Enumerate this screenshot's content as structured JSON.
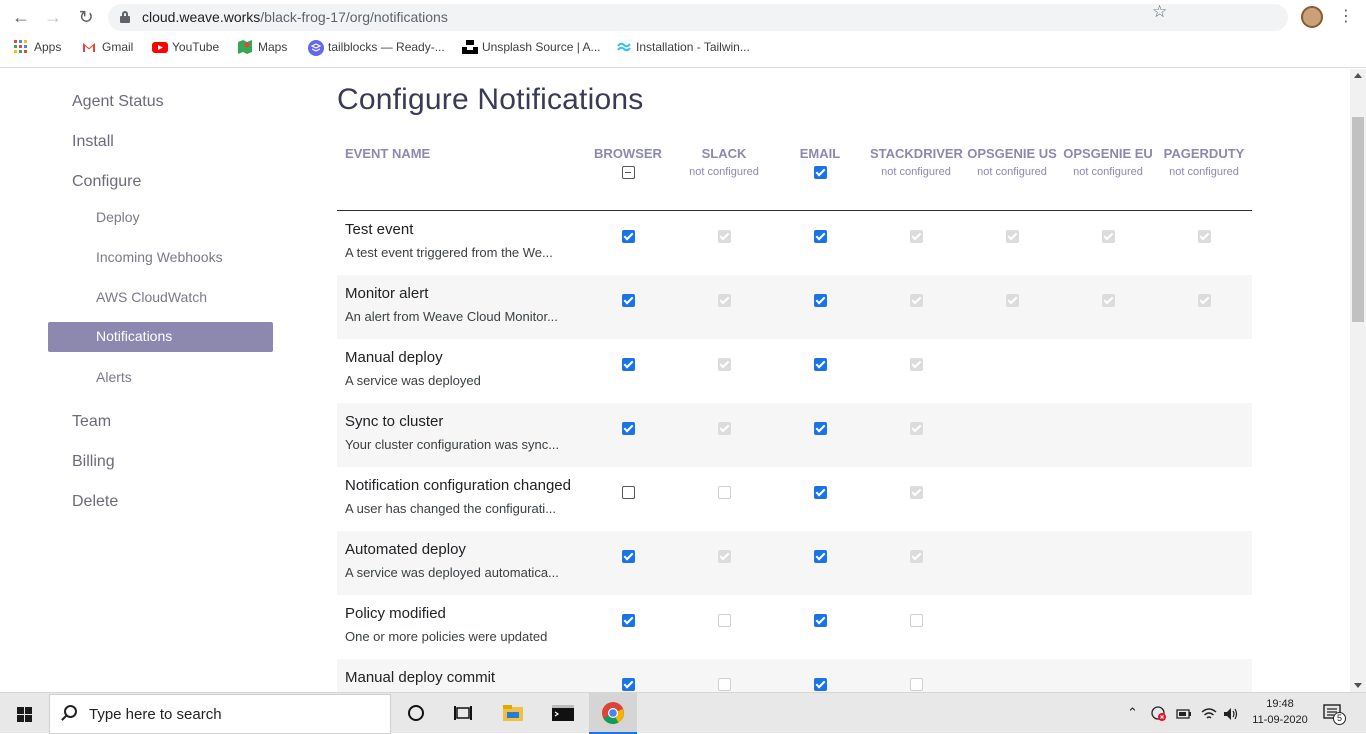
{
  "browser": {
    "url_host": "cloud.weave.works",
    "url_path": "/black-frog-17/org/notifications",
    "bookmarks": [
      {
        "label": "Apps",
        "icon": "apps-grid-icon"
      },
      {
        "label": "Gmail",
        "icon": "gmail-icon"
      },
      {
        "label": "YouTube",
        "icon": "youtube-icon"
      },
      {
        "label": "Maps",
        "icon": "maps-icon"
      },
      {
        "label": "tailblocks — Ready-...",
        "icon": "tailblocks-icon"
      },
      {
        "label": "Unsplash Source | A...",
        "icon": "unsplash-icon"
      },
      {
        "label": "Installation - Tailwin...",
        "icon": "tailwind-icon"
      }
    ]
  },
  "sidebar": {
    "items": [
      {
        "label": "Agent Status",
        "level": 1
      },
      {
        "label": "Install",
        "level": 1
      },
      {
        "label": "Configure",
        "level": 1
      },
      {
        "label": "Deploy",
        "level": 2
      },
      {
        "label": "Incoming Webhooks",
        "level": 2
      },
      {
        "label": "AWS CloudWatch",
        "level": 2
      },
      {
        "label": "Notifications",
        "level": 2,
        "active": true
      },
      {
        "label": "Alerts",
        "level": 2
      },
      {
        "label": "Team",
        "level": 1
      },
      {
        "label": "Billing",
        "level": 1
      },
      {
        "label": "Delete",
        "level": 1
      }
    ]
  },
  "main": {
    "title": "Configure Notifications",
    "columns": [
      {
        "key": "event",
        "label": "EVENT NAME",
        "sub": ""
      },
      {
        "key": "browser",
        "label": "BROWSER",
        "sub": "",
        "header_checkbox": "indeterminate"
      },
      {
        "key": "slack",
        "label": "SLACK",
        "sub": "not configured"
      },
      {
        "key": "email",
        "label": "EMAIL",
        "sub": "",
        "header_checkbox": "checked"
      },
      {
        "key": "stackdriver",
        "label": "STACKDRIVER",
        "sub": "not configured"
      },
      {
        "key": "opsgenie_us",
        "label": "OPSGENIE US",
        "sub": "not configured"
      },
      {
        "key": "opsgenie_eu",
        "label": "OPSGENIE EU",
        "sub": "not configured"
      },
      {
        "key": "pagerduty",
        "label": "PAGERDUTY",
        "sub": "not configured"
      }
    ],
    "rows": [
      {
        "name": "Test event",
        "desc": "A test event triggered from the We...",
        "cells": [
          "on",
          "dis-on",
          "on",
          "dis-on",
          "dis-on",
          "dis-on",
          "dis-on"
        ]
      },
      {
        "name": "Monitor alert",
        "desc": "An alert from Weave Cloud Monitor...",
        "cells": [
          "on",
          "dis-on",
          "on",
          "dis-on",
          "dis-on",
          "dis-on",
          "dis-on"
        ]
      },
      {
        "name": "Manual deploy",
        "desc": "A service was deployed",
        "cells": [
          "on",
          "dis-on",
          "on",
          "dis-on",
          "none",
          "none",
          "none"
        ]
      },
      {
        "name": "Sync to cluster",
        "desc": "Your cluster configuration was sync...",
        "cells": [
          "on",
          "dis-on",
          "on",
          "dis-on",
          "none",
          "none",
          "none"
        ]
      },
      {
        "name": "Notification configuration changed",
        "desc": "A user has changed the configurati...",
        "cells": [
          "off",
          "dis-off",
          "on",
          "dis-on",
          "none",
          "none",
          "none"
        ]
      },
      {
        "name": "Automated deploy",
        "desc": "A service was deployed automatica...",
        "cells": [
          "on",
          "dis-on",
          "on",
          "dis-on",
          "none",
          "none",
          "none"
        ]
      },
      {
        "name": "Policy modified",
        "desc": "One or more policies were updated",
        "cells": [
          "on",
          "dis-off",
          "on",
          "dis-off",
          "none",
          "none",
          "none"
        ]
      },
      {
        "name": "Manual deploy commit",
        "desc": "",
        "cells": [
          "on",
          "dis-off",
          "on",
          "dis-off",
          "none",
          "none",
          "none"
        ]
      }
    ]
  },
  "taskbar": {
    "search_placeholder": "Type here to search",
    "time": "19:48",
    "date": "11-09-2020",
    "notifications_count": "5"
  }
}
